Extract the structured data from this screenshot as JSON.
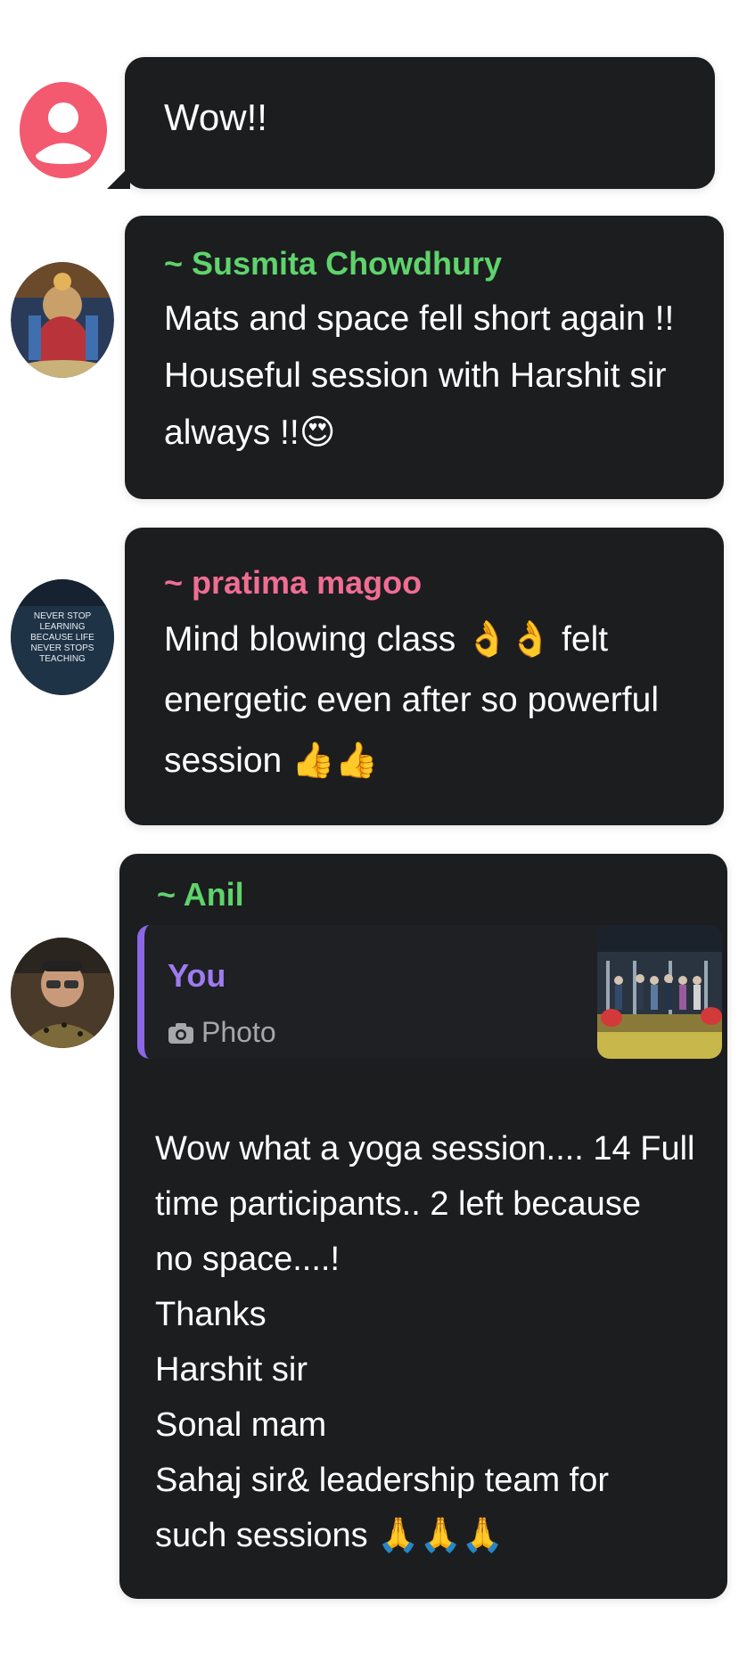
{
  "messages": [
    {
      "id": "m1",
      "sender": "",
      "text": "Wow!!",
      "avatar": "default-user-icon"
    },
    {
      "id": "m2",
      "sender": "~ Susmita Chowdhury",
      "text": "Mats and space fell short again !!\nHouseful session with Harshit sir\nalways !!😍",
      "sender_color": "#5fd36c",
      "avatar": "deity-painting-avatar"
    },
    {
      "id": "m3",
      "sender": "~ pratima magoo",
      "text": "Mind blowing class 👌👌 felt\nenergetic even after so powerful\nsession 👍👍",
      "sender_color": "#f06d94",
      "avatar": "quote-poster-avatar",
      "avatar_text": "NEVER STOP LEARNING BECAUSE LIFE NEVER STOPS TEACHING"
    },
    {
      "id": "m4",
      "sender": "~ Anil",
      "sender_color": "#5fd36c",
      "avatar": "man-with-glasses-avatar",
      "quote": {
        "author": "You",
        "type_label": "Photo",
        "type_icon": "camera-icon"
      },
      "text": "Wow what a yoga session.... 14 Full\ntime participants.. 2 left because\nno space....!\nThanks\nHarshit sir\nSonal mam\nSahaj sir& leadership team for\nsuch sessions 🙏🙏🙏"
    }
  ],
  "colors": {
    "bubble": "#1c1d1f",
    "page": "#ffffff",
    "quote_accent": "#8b67e6",
    "default_avatar": "#f35a6f"
  }
}
